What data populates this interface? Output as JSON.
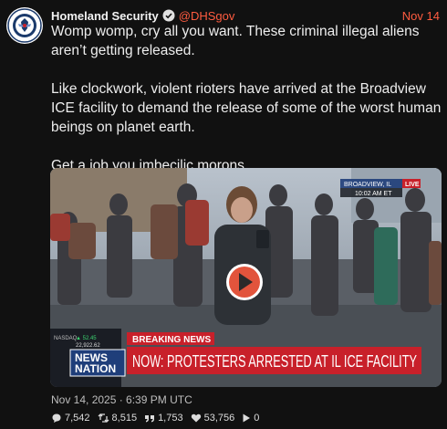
{
  "account": {
    "name": "Homeland Security",
    "handle": "@DHSgov",
    "avatar_icon": "dhs-seal-icon",
    "verified_icon": "verified-badge-icon"
  },
  "post": {
    "date": "Nov 14",
    "paragraphs": [
      "Womp womp, cry all you want. These criminal illegal aliens aren’t getting released.",
      "Like clockwork, violent rioters have arrived at the Broadview ICE facility to demand the release of some of the worst human beings on planet earth.",
      "Get a job you imbecilic morons."
    ],
    "timestamp": "Nov 14, 2025 · 6:39 PM UTC"
  },
  "video": {
    "location": "BROADVIEW, IL",
    "time": "10:02 AM ET",
    "live_label": "LIVE",
    "ticker_label": "NASDAQ",
    "ticker_change": "▲ 52.45",
    "ticker_value": "22,922.62",
    "network": "NEWS NATION",
    "breaking_label": "BREAKING NEWS",
    "headline": "NOW: PROTESTERS ARRESTED AT IL ICE FACILITY",
    "play_icon": "play-icon"
  },
  "stats": {
    "replies": "7,542",
    "reposts": "8,515",
    "quotes": "1,753",
    "likes": "53,756",
    "views": "0"
  },
  "colors": {
    "accent": "#ff5c40",
    "background": "#111111",
    "breaking_red": "#c8202a",
    "network_blue": "#1f3e7a"
  }
}
